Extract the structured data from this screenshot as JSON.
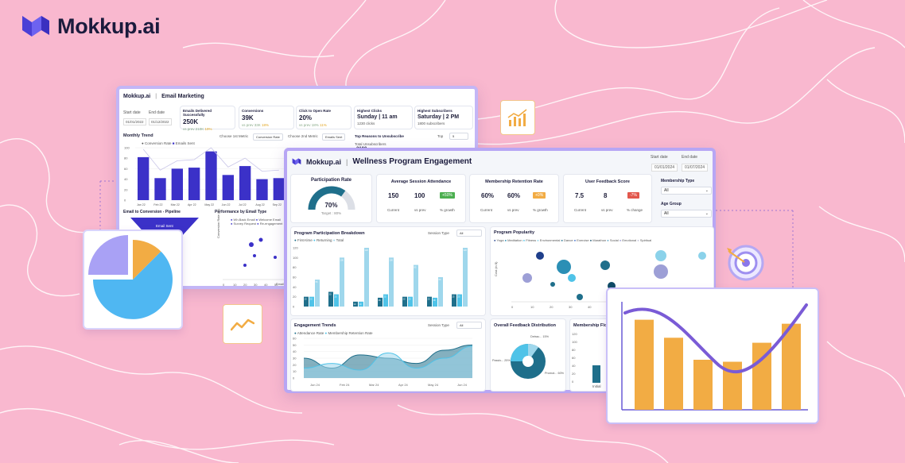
{
  "brand": {
    "name": "Mokkup.ai",
    "accent": "#4a3fd6"
  },
  "email_window": {
    "logo": "Mokkup.ai",
    "title": "Email Marketing",
    "start_date_label": "Start date",
    "start_date": "01/01/2022",
    "end_date_label": "End date",
    "end_date": "01/12/2022",
    "kpis": [
      {
        "label": "Emails Delivered Successfully",
        "value": "250K",
        "sub": "vs prev 210K",
        "delta": "19%"
      },
      {
        "label": "Conversions",
        "value": "39K",
        "sub": "vs prev 33K",
        "delta": "18%"
      },
      {
        "label": "Click to Open Rate",
        "value": "20%",
        "sub": "vs prev 18%",
        "delta": "11%"
      },
      {
        "label": "Highest Clicks",
        "value": "Sunday | 11 am",
        "sub": "1230 clicks"
      },
      {
        "label": "Highest Subscribers",
        "value": "Saturday | 2 PM",
        "sub": "1800 subscribers"
      }
    ],
    "monthly_trend_title": "Monthly Trend",
    "legend": [
      "Conversion Rate",
      "Emails Sent"
    ],
    "choose_first_label": "Choose 1st Metric",
    "choose_first_value": "Conversion Rate",
    "choose_second_label": "Choose 2nd Metric",
    "choose_second_value": "Emails Sent",
    "top_reasons_title": "Top Reasons to Unsubscribe",
    "top_label": "Top",
    "top_value": "5",
    "total_unsub_label": "Total Unsubscribers",
    "total_unsub_value": "2100",
    "months": [
      "Jan 22",
      "Feb 22",
      "Mar 22",
      "Apr 22",
      "May 22",
      "Jun 22",
      "Jul 22",
      "Aug 22",
      "Sep 22"
    ],
    "bars": [
      0.82,
      0.42,
      0.6,
      0.62,
      0.93,
      0.48,
      0.65,
      0.4,
      0.42
    ],
    "yticks": [
      "100",
      "80",
      "60",
      "40",
      "20",
      "0"
    ],
    "funnel_title": "Email to Conversion - Pipeline",
    "funnel_label": "Email Sent",
    "perf_title": "Performance by Email Type",
    "perf_legend": [
      "Wh.Back Email",
      "Welcome Email",
      "Survey Request",
      "Re-engagement"
    ],
    "perf_ylabel": "Conversion Rate (%)",
    "perf_xticks": [
      "0",
      "10",
      "20",
      "30",
      "40",
      "50",
      "60"
    ],
    "perf_xlabel": "Email"
  },
  "wellness": {
    "logo": "Mokkup.ai",
    "title": "Wellness Program Engagement",
    "start_date_label": "Start date",
    "start_date": "01/01/2024",
    "end_date_label": "End date",
    "end_date": "01/07/2024",
    "participation": {
      "title": "Participation Rate",
      "value": "70%",
      "target": "Target : 80%",
      "fraction": 0.7
    },
    "session_attendance": {
      "title": "Average Session Attendance",
      "current": "150",
      "prev": "100",
      "delta": "+50%",
      "labels": [
        "Current",
        "vs prev",
        "% growth"
      ]
    },
    "retention": {
      "title": "Membership Retention Rate",
      "current": "60%",
      "prev": "60%",
      "delta": "+0%",
      "labels": [
        "Current",
        "vs prev",
        "% growth"
      ]
    },
    "feedback": {
      "title": "User Feedback Score",
      "current": "7.5",
      "prev": "8",
      "delta": "-7%",
      "labels": [
        "Current",
        "vs prev",
        "% change"
      ]
    },
    "membership_type": {
      "label": "Membership Type",
      "value": "All"
    },
    "age_group": {
      "label": "Age Group",
      "value": "All"
    },
    "breakdown": {
      "title": "Program Participation Breakdown",
      "session_label": "Session Type",
      "session_value": "All",
      "legend": [
        "First-time",
        "Returning",
        "Total"
      ],
      "yticks": [
        "120",
        "100",
        "80",
        "60",
        "40",
        "20",
        "0"
      ]
    },
    "popularity": {
      "title": "Program Popularity",
      "legend": [
        "Yoga",
        "Meditation",
        "Fitness",
        "Environmental",
        "Dance",
        "Exercise",
        "Marathon",
        "Social",
        "Emotional",
        "Spiritual"
      ],
      "xticks": [
        "0",
        "10",
        "20",
        "30",
        "40",
        "50"
      ],
      "ylabel": "Cost (in $)"
    },
    "trends": {
      "title": "Engagement Trends",
      "session_label": "Session Type",
      "session_value": "All",
      "legend": [
        "Attendance Rate",
        "Membership Retention Rate"
      ],
      "yticks": [
        "60",
        "50",
        "40",
        "30",
        "20",
        "10",
        "0"
      ],
      "xticks": [
        "Jun 24",
        "Feb 24",
        "Mar 24",
        "Apr 24",
        "May 24",
        "Jun 24"
      ]
    },
    "feedback_dist": {
      "title": "Overall Feedback Distribution",
      "labels": [
        "Detrac... 15%",
        "Passiv... 25%",
        "Promot... 60%"
      ]
    },
    "membership_flow": {
      "title": "Membership Flow",
      "yticks": [
        "120",
        "100",
        "80",
        "60",
        "40",
        "20",
        "0"
      ],
      "xlabel": "Initial"
    }
  },
  "colors": {
    "bg": "#f9b8cf",
    "purple": "#3b31c8",
    "teal": "#1f6f8b",
    "sky": "#4fc3e8",
    "orange": "#f2ac44",
    "violet": "#7a5bd6"
  }
}
